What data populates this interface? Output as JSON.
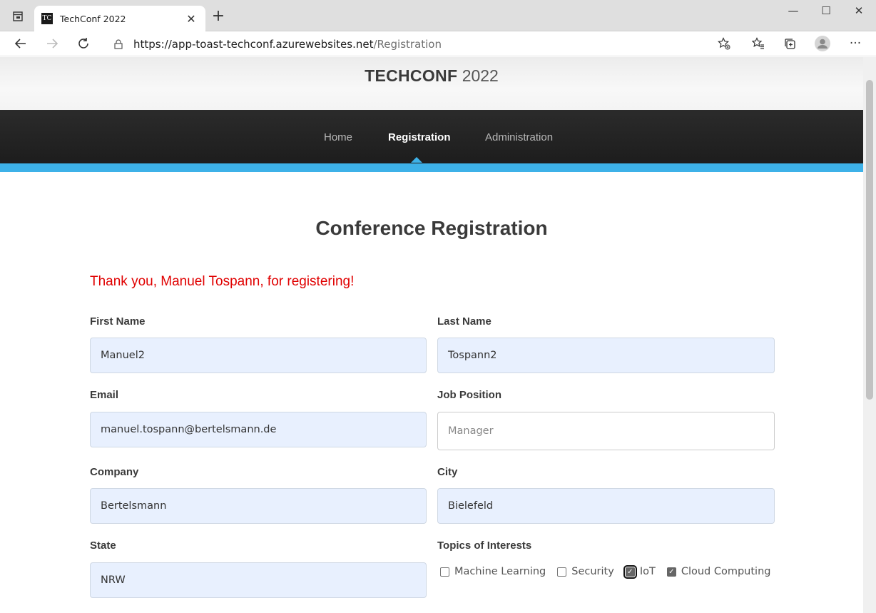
{
  "browser": {
    "tab_title": "TechConf 2022",
    "tab_favicon_text": "TC",
    "url_host": "https://app-toast-techconf.azurewebsites.net",
    "url_path": "/Registration"
  },
  "site": {
    "brand": "TECHCONF",
    "year": "2022",
    "nav": [
      {
        "label": "Home",
        "active": false
      },
      {
        "label": "Registration",
        "active": true
      },
      {
        "label": "Administration",
        "active": false
      }
    ],
    "accent_color": "#3db1e8"
  },
  "page": {
    "title": "Conference Registration",
    "confirmation": "Thank you, Manuel Tospann, for registering!",
    "confirmation_color": "#e00000"
  },
  "form": {
    "first_name": {
      "label": "First Name",
      "value": "Manuel2"
    },
    "last_name": {
      "label": "Last Name",
      "value": "Tospann2"
    },
    "email": {
      "label": "Email",
      "value": "manuel.tospann@bertelsmann.de"
    },
    "job_position": {
      "label": "Job Position",
      "placeholder": "Manager"
    },
    "company": {
      "label": "Company",
      "value": "Bertelsmann"
    },
    "city": {
      "label": "City",
      "value": "Bielefeld"
    },
    "state": {
      "label": "State",
      "value": "NRW"
    },
    "topics": {
      "label": "Topics of Interests",
      "options": [
        {
          "label": "Machine Learning",
          "checked": false
        },
        {
          "label": "Security",
          "checked": false
        },
        {
          "label": "IoT",
          "checked": true
        },
        {
          "label": "Cloud Computing",
          "checked": true
        }
      ]
    }
  }
}
